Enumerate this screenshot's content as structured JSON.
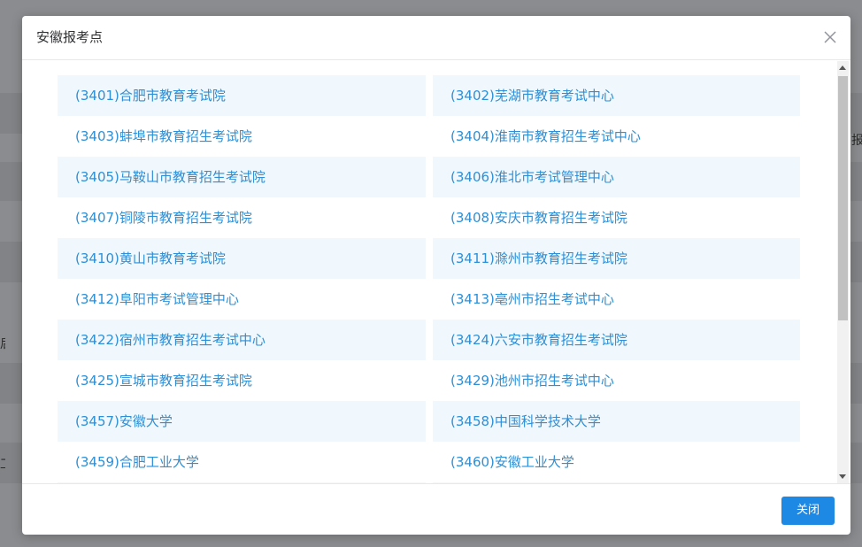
{
  "background": {
    "right_char": "报",
    "left_char_1": "后",
    "left_char_2": "工"
  },
  "dialog": {
    "title": "安徽报考点",
    "close_icon": "close-icon",
    "close_button_label": "关闭",
    "accent_color": "#1e88e5",
    "link_color": "#2d8fd5"
  },
  "sites": [
    [
      "(3401)合肥市教育考试院",
      "(3402)芜湖市教育考试中心"
    ],
    [
      "(3403)蚌埠市教育招生考试院",
      "(3404)淮南市教育招生考试中心"
    ],
    [
      "(3405)马鞍山市教育招生考试院",
      "(3406)淮北市考试管理中心"
    ],
    [
      "(3407)铜陵市教育招生考试院",
      "(3408)安庆市教育招生考试院"
    ],
    [
      "(3410)黄山市教育考试院",
      "(3411)滁州市教育招生考试院"
    ],
    [
      "(3412)阜阳市考试管理中心",
      "(3413)亳州市招生考试中心"
    ],
    [
      "(3422)宿州市教育招生考试中心",
      "(3424)六安市教育招生考试院"
    ],
    [
      "(3425)宣城市教育招生考试院",
      "(3429)池州市招生考试中心"
    ],
    [
      "(3457)安徽大学",
      "(3458)中国科学技术大学"
    ],
    [
      "(3459)合肥工业大学",
      "(3460)安徽工业大学"
    ]
  ]
}
